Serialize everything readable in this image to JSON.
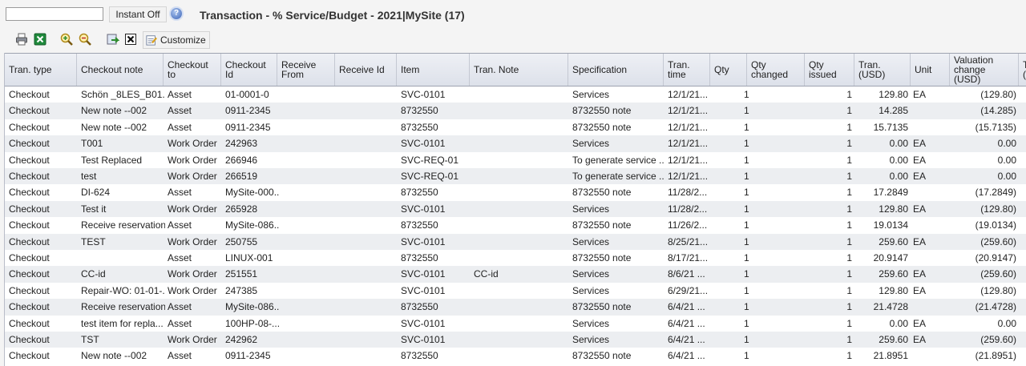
{
  "search": {
    "value": "",
    "placeholder": ""
  },
  "toolbar": {
    "instant_label": "Instant Off",
    "customize_label": "Customize",
    "icons": [
      "print-icon",
      "excel-export-icon",
      "zoom-in-icon",
      "zoom-out-icon",
      "refresh-icon",
      "close-icon",
      "customize-icon"
    ]
  },
  "page": {
    "title": "Transaction - % Service/Budget - 2021|MySite (17)"
  },
  "columns": [
    "Tran. type",
    "Checkout note",
    "Checkout\nto",
    "Checkout\nId",
    "Receive\nFrom",
    "Receive Id",
    "Item",
    "Tran. Note",
    "Specification",
    "Tran.\ntime",
    "Qty",
    "Qty\nchanged",
    "Qty\nissued",
    "Tran.\n(USD)",
    "Unit",
    "Valuation\nchange\n(USD)",
    "T\n(U"
  ],
  "rows": [
    [
      "Checkout",
      "Schön _8LES_B01...",
      "Asset",
      "01-0001-0",
      "",
      "",
      "SVC-0101",
      "",
      "Services",
      "12/1/21...",
      "1",
      "",
      "1",
      "129.80",
      "EA",
      "(129.80)"
    ],
    [
      "Checkout",
      "New note --002",
      "Asset",
      "0911-2345",
      "",
      "",
      "8732550",
      "",
      "8732550 note",
      "12/1/21...",
      "1",
      "",
      "1",
      "14.285",
      "",
      "(14.285)"
    ],
    [
      "Checkout",
      "New note --002",
      "Asset",
      "0911-2345",
      "",
      "",
      "8732550",
      "",
      "8732550 note",
      "12/1/21...",
      "1",
      "",
      "1",
      "15.7135",
      "",
      "(15.7135)"
    ],
    [
      "Checkout",
      "T001",
      "Work Order",
      "242963",
      "",
      "",
      "SVC-0101",
      "",
      "Services",
      "12/1/21...",
      "1",
      "",
      "1",
      "0.00",
      "EA",
      "0.00"
    ],
    [
      "Checkout",
      "Test Replaced",
      "Work Order",
      "266946",
      "",
      "",
      "SVC-REQ-01",
      "",
      "To generate service ...",
      "12/1/21...",
      "1",
      "",
      "1",
      "0.00",
      "EA",
      "0.00"
    ],
    [
      "Checkout",
      "test",
      "Work Order",
      "266519",
      "",
      "",
      "SVC-REQ-01",
      "",
      "To generate service ...",
      "12/1/21...",
      "1",
      "",
      "1",
      "0.00",
      "EA",
      "0.00"
    ],
    [
      "Checkout",
      "DI-624",
      "Asset",
      "MySite-000...",
      "",
      "",
      "8732550",
      "",
      "8732550 note",
      "11/28/2...",
      "1",
      "",
      "1",
      "17.2849",
      "",
      "(17.2849)"
    ],
    [
      "Checkout",
      "Test it",
      "Work Order",
      "265928",
      "",
      "",
      "SVC-0101",
      "",
      "Services",
      "11/28/2...",
      "1",
      "",
      "1",
      "129.80",
      "EA",
      "(129.80)"
    ],
    [
      "Checkout",
      "Receive reservation",
      "Asset",
      "MySite-086...",
      "",
      "",
      "8732550",
      "",
      "8732550 note",
      "11/26/2...",
      "1",
      "",
      "1",
      "19.0134",
      "",
      "(19.0134)"
    ],
    [
      "Checkout",
      "TEST",
      "Work Order",
      "250755",
      "",
      "",
      "SVC-0101",
      "",
      "Services",
      "8/25/21...",
      "1",
      "",
      "1",
      "259.60",
      "EA",
      "(259.60)"
    ],
    [
      "Checkout",
      "",
      "Asset",
      "LINUX-001",
      "",
      "",
      "8732550",
      "",
      "8732550 note",
      "8/17/21...",
      "1",
      "",
      "1",
      "20.9147",
      "",
      "(20.9147)"
    ],
    [
      "Checkout",
      "CC-id",
      "Work Order",
      "251551",
      "",
      "",
      "SVC-0101",
      "CC-id",
      "Services",
      "8/6/21 ...",
      "1",
      "",
      "1",
      "259.60",
      "EA",
      "(259.60)"
    ],
    [
      "Checkout",
      "Repair-WO: 01-01-...",
      "Work Order",
      "247385",
      "",
      "",
      "SVC-0101",
      "",
      "Services",
      "6/29/21...",
      "1",
      "",
      "1",
      "129.80",
      "EA",
      "(129.80)"
    ],
    [
      "Checkout",
      "Receive reservation",
      "Asset",
      "MySite-086...",
      "",
      "",
      "8732550",
      "",
      "8732550 note",
      "6/4/21 ...",
      "1",
      "",
      "1",
      "21.4728",
      "",
      "(21.4728)"
    ],
    [
      "Checkout",
      "test item for repla...",
      "Asset",
      "100HP-08-...",
      "",
      "",
      "SVC-0101",
      "",
      "Services",
      "6/4/21 ...",
      "1",
      "",
      "1",
      "0.00",
      "EA",
      "0.00"
    ],
    [
      "Checkout",
      "TST",
      "Work Order",
      "242962",
      "",
      "",
      "SVC-0101",
      "",
      "Services",
      "6/4/21 ...",
      "1",
      "",
      "1",
      "259.60",
      "EA",
      "(259.60)"
    ],
    [
      "Checkout",
      "New note --002",
      "Asset",
      "0911-2345",
      "",
      "",
      "8732550",
      "",
      "8732550 note",
      "6/4/21 ...",
      "1",
      "",
      "1",
      "21.8951",
      "",
      "(21.8951)"
    ]
  ]
}
